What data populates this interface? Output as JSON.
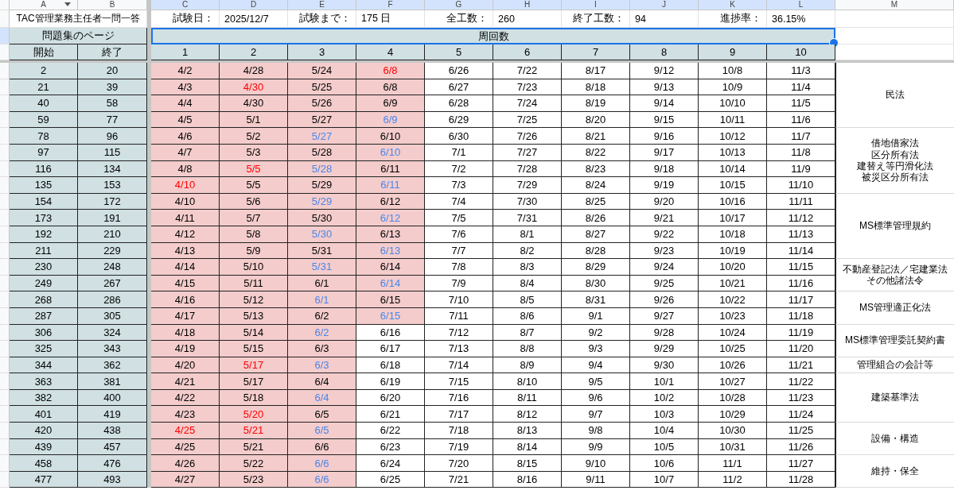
{
  "column_headers": [
    {
      "letter": "A",
      "selected": false,
      "dropdown": true
    },
    {
      "letter": "B",
      "selected": false
    },
    {
      "letter": "C",
      "selected": true
    },
    {
      "letter": "D",
      "selected": true
    },
    {
      "letter": "E",
      "selected": true
    },
    {
      "letter": "F",
      "selected": true
    },
    {
      "letter": "G",
      "selected": true
    },
    {
      "letter": "H",
      "selected": true
    },
    {
      "letter": "I",
      "selected": true
    },
    {
      "letter": "J",
      "selected": true
    },
    {
      "letter": "K",
      "selected": true
    },
    {
      "letter": "L",
      "selected": true
    },
    {
      "letter": "M",
      "selected": false
    }
  ],
  "title": "TAC管理業務主任者一問一答",
  "info": [
    {
      "label": "試験日：",
      "value": "2025/12/7"
    },
    {
      "label": "試験まで：",
      "value": "175 日"
    },
    {
      "label": "全工数：",
      "value": "260"
    },
    {
      "label": "終了工数：",
      "value": "94"
    },
    {
      "label": "進捗率：",
      "value": "36.15%"
    }
  ],
  "pages_header": "問題集のページ",
  "rounds_header": {
    "text": "周回数",
    "selected": true
  },
  "page_columns": [
    "開始",
    "終了"
  ],
  "round_numbers": [
    "1",
    "2",
    "3",
    "4",
    "5",
    "6",
    "7",
    "8",
    "9",
    "10"
  ],
  "groups": [
    {
      "subject": [
        "民法"
      ],
      "rows": [
        {
          "start": "2",
          "end": "20",
          "dates": [
            {
              "text": "4/2",
              "done": true,
              "color": "#000000"
            },
            {
              "text": "4/28",
              "done": true,
              "color": "#000000"
            },
            {
              "text": "5/24",
              "done": true,
              "color": "#000000"
            },
            {
              "text": "6/8",
              "done": true,
              "color": "#ff0000"
            },
            {
              "text": "6/26",
              "done": false,
              "color": "#000000"
            },
            {
              "text": "7/22",
              "done": false,
              "color": "#000000"
            },
            {
              "text": "8/17",
              "done": false,
              "color": "#000000"
            },
            {
              "text": "9/12",
              "done": false,
              "color": "#000000"
            },
            {
              "text": "10/8",
              "done": false,
              "color": "#000000"
            },
            {
              "text": "11/3",
              "done": false,
              "color": "#000000"
            }
          ]
        },
        {
          "start": "21",
          "end": "39",
          "dates": [
            {
              "text": "4/3",
              "done": true,
              "color": "#000000"
            },
            {
              "text": "4/30",
              "done": true,
              "color": "#ff0000"
            },
            {
              "text": "5/25",
              "done": true,
              "color": "#000000"
            },
            {
              "text": "6/8",
              "done": true,
              "color": "#000000"
            },
            {
              "text": "6/27",
              "done": false,
              "color": "#000000"
            },
            {
              "text": "7/23",
              "done": false,
              "color": "#000000"
            },
            {
              "text": "8/18",
              "done": false,
              "color": "#000000"
            },
            {
              "text": "9/13",
              "done": false,
              "color": "#000000"
            },
            {
              "text": "10/9",
              "done": false,
              "color": "#000000"
            },
            {
              "text": "11/4",
              "done": false,
              "color": "#000000"
            }
          ]
        },
        {
          "start": "40",
          "end": "58",
          "dates": [
            {
              "text": "4/4",
              "done": true,
              "color": "#000000"
            },
            {
              "text": "4/30",
              "done": true,
              "color": "#000000"
            },
            {
              "text": "5/26",
              "done": true,
              "color": "#000000"
            },
            {
              "text": "6/9",
              "done": true,
              "color": "#000000"
            },
            {
              "text": "6/28",
              "done": false,
              "color": "#000000"
            },
            {
              "text": "7/24",
              "done": false,
              "color": "#000000"
            },
            {
              "text": "8/19",
              "done": false,
              "color": "#000000"
            },
            {
              "text": "9/14",
              "done": false,
              "color": "#000000"
            },
            {
              "text": "10/10",
              "done": false,
              "color": "#000000"
            },
            {
              "text": "11/5",
              "done": false,
              "color": "#000000"
            }
          ]
        },
        {
          "start": "59",
          "end": "77",
          "dates": [
            {
              "text": "4/5",
              "done": true,
              "color": "#000000"
            },
            {
              "text": "5/1",
              "done": true,
              "color": "#000000"
            },
            {
              "text": "5/27",
              "done": true,
              "color": "#000000"
            },
            {
              "text": "6/9",
              "done": true,
              "color": "#4a86e8"
            },
            {
              "text": "6/29",
              "done": false,
              "color": "#000000"
            },
            {
              "text": "7/25",
              "done": false,
              "color": "#000000"
            },
            {
              "text": "8/20",
              "done": false,
              "color": "#000000"
            },
            {
              "text": "9/15",
              "done": false,
              "color": "#000000"
            },
            {
              "text": "10/11",
              "done": false,
              "color": "#000000"
            },
            {
              "text": "11/6",
              "done": false,
              "color": "#000000"
            }
          ]
        }
      ]
    },
    {
      "subject": [
        "借地借家法",
        "区分所有法",
        "建替え等円滑化法",
        "被災区分所有法"
      ],
      "rows": [
        {
          "start": "78",
          "end": "96",
          "dates": [
            {
              "text": "4/6",
              "done": true,
              "color": "#000000"
            },
            {
              "text": "5/2",
              "done": true,
              "color": "#000000"
            },
            {
              "text": "5/27",
              "done": true,
              "color": "#4a86e8"
            },
            {
              "text": "6/10",
              "done": true,
              "color": "#000000"
            },
            {
              "text": "6/30",
              "done": false,
              "color": "#000000"
            },
            {
              "text": "7/26",
              "done": false,
              "color": "#000000"
            },
            {
              "text": "8/21",
              "done": false,
              "color": "#000000"
            },
            {
              "text": "9/16",
              "done": false,
              "color": "#000000"
            },
            {
              "text": "10/12",
              "done": false,
              "color": "#000000"
            },
            {
              "text": "11/7",
              "done": false,
              "color": "#000000"
            }
          ]
        },
        {
          "start": "97",
          "end": "115",
          "dates": [
            {
              "text": "4/7",
              "done": true,
              "color": "#000000"
            },
            {
              "text": "5/3",
              "done": true,
              "color": "#000000"
            },
            {
              "text": "5/28",
              "done": true,
              "color": "#000000"
            },
            {
              "text": "6/10",
              "done": true,
              "color": "#4a86e8"
            },
            {
              "text": "7/1",
              "done": false,
              "color": "#000000"
            },
            {
              "text": "7/27",
              "done": false,
              "color": "#000000"
            },
            {
              "text": "8/22",
              "done": false,
              "color": "#000000"
            },
            {
              "text": "9/17",
              "done": false,
              "color": "#000000"
            },
            {
              "text": "10/13",
              "done": false,
              "color": "#000000"
            },
            {
              "text": "11/8",
              "done": false,
              "color": "#000000"
            }
          ]
        },
        {
          "start": "116",
          "end": "134",
          "dates": [
            {
              "text": "4/8",
              "done": true,
              "color": "#000000"
            },
            {
              "text": "5/5",
              "done": true,
              "color": "#ff0000"
            },
            {
              "text": "5/28",
              "done": true,
              "color": "#4a86e8"
            },
            {
              "text": "6/11",
              "done": true,
              "color": "#000000"
            },
            {
              "text": "7/2",
              "done": false,
              "color": "#000000"
            },
            {
              "text": "7/28",
              "done": false,
              "color": "#000000"
            },
            {
              "text": "8/23",
              "done": false,
              "color": "#000000"
            },
            {
              "text": "9/18",
              "done": false,
              "color": "#000000"
            },
            {
              "text": "10/14",
              "done": false,
              "color": "#000000"
            },
            {
              "text": "11/9",
              "done": false,
              "color": "#000000"
            }
          ]
        },
        {
          "start": "135",
          "end": "153",
          "dates": [
            {
              "text": "4/10",
              "done": true,
              "color": "#ff0000"
            },
            {
              "text": "5/5",
              "done": true,
              "color": "#000000"
            },
            {
              "text": "5/29",
              "done": true,
              "color": "#000000"
            },
            {
              "text": "6/11",
              "done": true,
              "color": "#4a86e8"
            },
            {
              "text": "7/3",
              "done": false,
              "color": "#000000"
            },
            {
              "text": "7/29",
              "done": false,
              "color": "#000000"
            },
            {
              "text": "8/24",
              "done": false,
              "color": "#000000"
            },
            {
              "text": "9/19",
              "done": false,
              "color": "#000000"
            },
            {
              "text": "10/15",
              "done": false,
              "color": "#000000"
            },
            {
              "text": "11/10",
              "done": false,
              "color": "#000000"
            }
          ]
        }
      ]
    },
    {
      "subject": [
        "MS標準管理規約"
      ],
      "rows": [
        {
          "start": "154",
          "end": "172",
          "dates": [
            {
              "text": "4/10",
              "done": true,
              "color": "#000000"
            },
            {
              "text": "5/6",
              "done": true,
              "color": "#000000"
            },
            {
              "text": "5/29",
              "done": true,
              "color": "#4a86e8"
            },
            {
              "text": "6/12",
              "done": true,
              "color": "#000000"
            },
            {
              "text": "7/4",
              "done": false,
              "color": "#000000"
            },
            {
              "text": "7/30",
              "done": false,
              "color": "#000000"
            },
            {
              "text": "8/25",
              "done": false,
              "color": "#000000"
            },
            {
              "text": "9/20",
              "done": false,
              "color": "#000000"
            },
            {
              "text": "10/16",
              "done": false,
              "color": "#000000"
            },
            {
              "text": "11/11",
              "done": false,
              "color": "#000000"
            }
          ]
        },
        {
          "start": "173",
          "end": "191",
          "dates": [
            {
              "text": "4/11",
              "done": true,
              "color": "#000000"
            },
            {
              "text": "5/7",
              "done": true,
              "color": "#000000"
            },
            {
              "text": "5/30",
              "done": true,
              "color": "#000000"
            },
            {
              "text": "6/12",
              "done": true,
              "color": "#4a86e8"
            },
            {
              "text": "7/5",
              "done": false,
              "color": "#000000"
            },
            {
              "text": "7/31",
              "done": false,
              "color": "#000000"
            },
            {
              "text": "8/26",
              "done": false,
              "color": "#000000"
            },
            {
              "text": "9/21",
              "done": false,
              "color": "#000000"
            },
            {
              "text": "10/17",
              "done": false,
              "color": "#000000"
            },
            {
              "text": "11/12",
              "done": false,
              "color": "#000000"
            }
          ]
        },
        {
          "start": "192",
          "end": "210",
          "dates": [
            {
              "text": "4/12",
              "done": true,
              "color": "#000000"
            },
            {
              "text": "5/8",
              "done": true,
              "color": "#000000"
            },
            {
              "text": "5/30",
              "done": true,
              "color": "#4a86e8"
            },
            {
              "text": "6/13",
              "done": true,
              "color": "#000000"
            },
            {
              "text": "7/6",
              "done": false,
              "color": "#000000"
            },
            {
              "text": "8/1",
              "done": false,
              "color": "#000000"
            },
            {
              "text": "8/27",
              "done": false,
              "color": "#000000"
            },
            {
              "text": "9/22",
              "done": false,
              "color": "#000000"
            },
            {
              "text": "10/18",
              "done": false,
              "color": "#000000"
            },
            {
              "text": "11/13",
              "done": false,
              "color": "#000000"
            }
          ]
        },
        {
          "start": "211",
          "end": "229",
          "dates": [
            {
              "text": "4/13",
              "done": true,
              "color": "#000000"
            },
            {
              "text": "5/9",
              "done": true,
              "color": "#000000"
            },
            {
              "text": "5/31",
              "done": true,
              "color": "#000000"
            },
            {
              "text": "6/13",
              "done": true,
              "color": "#4a86e8"
            },
            {
              "text": "7/7",
              "done": false,
              "color": "#000000"
            },
            {
              "text": "8/2",
              "done": false,
              "color": "#000000"
            },
            {
              "text": "8/28",
              "done": false,
              "color": "#000000"
            },
            {
              "text": "9/23",
              "done": false,
              "color": "#000000"
            },
            {
              "text": "10/19",
              "done": false,
              "color": "#000000"
            },
            {
              "text": "11/14",
              "done": false,
              "color": "#000000"
            }
          ]
        }
      ]
    },
    {
      "subject": [
        "不動産登記法／宅建業法",
        "その他諸法令"
      ],
      "rows": [
        {
          "start": "230",
          "end": "248",
          "dates": [
            {
              "text": "4/14",
              "done": true,
              "color": "#000000"
            },
            {
              "text": "5/10",
              "done": true,
              "color": "#000000"
            },
            {
              "text": "5/31",
              "done": true,
              "color": "#4a86e8"
            },
            {
              "text": "6/14",
              "done": true,
              "color": "#000000"
            },
            {
              "text": "7/8",
              "done": false,
              "color": "#000000"
            },
            {
              "text": "8/3",
              "done": false,
              "color": "#000000"
            },
            {
              "text": "8/29",
              "done": false,
              "color": "#000000"
            },
            {
              "text": "9/24",
              "done": false,
              "color": "#000000"
            },
            {
              "text": "10/20",
              "done": false,
              "color": "#000000"
            },
            {
              "text": "11/15",
              "done": false,
              "color": "#000000"
            }
          ]
        },
        {
          "start": "249",
          "end": "267",
          "dates": [
            {
              "text": "4/15",
              "done": true,
              "color": "#000000"
            },
            {
              "text": "5/11",
              "done": true,
              "color": "#000000"
            },
            {
              "text": "6/1",
              "done": true,
              "color": "#000000"
            },
            {
              "text": "6/14",
              "done": true,
              "color": "#4a86e8"
            },
            {
              "text": "7/9",
              "done": false,
              "color": "#000000"
            },
            {
              "text": "8/4",
              "done": false,
              "color": "#000000"
            },
            {
              "text": "8/30",
              "done": false,
              "color": "#000000"
            },
            {
              "text": "9/25",
              "done": false,
              "color": "#000000"
            },
            {
              "text": "10/21",
              "done": false,
              "color": "#000000"
            },
            {
              "text": "11/16",
              "done": false,
              "color": "#000000"
            }
          ]
        }
      ]
    },
    {
      "subject": [
        "MS管理適正化法"
      ],
      "rows": [
        {
          "start": "268",
          "end": "286",
          "dates": [
            {
              "text": "4/16",
              "done": true,
              "color": "#000000"
            },
            {
              "text": "5/12",
              "done": true,
              "color": "#000000"
            },
            {
              "text": "6/1",
              "done": true,
              "color": "#4a86e8"
            },
            {
              "text": "6/15",
              "done": true,
              "color": "#000000"
            },
            {
              "text": "7/10",
              "done": false,
              "color": "#000000"
            },
            {
              "text": "8/5",
              "done": false,
              "color": "#000000"
            },
            {
              "text": "8/31",
              "done": false,
              "color": "#000000"
            },
            {
              "text": "9/26",
              "done": false,
              "color": "#000000"
            },
            {
              "text": "10/22",
              "done": false,
              "color": "#000000"
            },
            {
              "text": "11/17",
              "done": false,
              "color": "#000000"
            }
          ]
        },
        {
          "start": "287",
          "end": "305",
          "dates": [
            {
              "text": "4/17",
              "done": true,
              "color": "#000000"
            },
            {
              "text": "5/13",
              "done": true,
              "color": "#000000"
            },
            {
              "text": "6/2",
              "done": true,
              "color": "#000000"
            },
            {
              "text": "6/15",
              "done": true,
              "color": "#4a86e8"
            },
            {
              "text": "7/11",
              "done": false,
              "color": "#000000"
            },
            {
              "text": "8/6",
              "done": false,
              "color": "#000000"
            },
            {
              "text": "9/1",
              "done": false,
              "color": "#000000"
            },
            {
              "text": "9/27",
              "done": false,
              "color": "#000000"
            },
            {
              "text": "10/23",
              "done": false,
              "color": "#000000"
            },
            {
              "text": "11/18",
              "done": false,
              "color": "#000000"
            }
          ]
        }
      ]
    },
    {
      "subject": [
        "MS標準管理委託契約書"
      ],
      "rows": [
        {
          "start": "306",
          "end": "324",
          "dates": [
            {
              "text": "4/18",
              "done": true,
              "color": "#000000"
            },
            {
              "text": "5/14",
              "done": true,
              "color": "#000000"
            },
            {
              "text": "6/2",
              "done": true,
              "color": "#4a86e8"
            },
            {
              "text": "6/16",
              "done": false,
              "color": "#000000"
            },
            {
              "text": "7/12",
              "done": false,
              "color": "#000000"
            },
            {
              "text": "8/7",
              "done": false,
              "color": "#000000"
            },
            {
              "text": "9/2",
              "done": false,
              "color": "#000000"
            },
            {
              "text": "9/28",
              "done": false,
              "color": "#000000"
            },
            {
              "text": "10/24",
              "done": false,
              "color": "#000000"
            },
            {
              "text": "11/19",
              "done": false,
              "color": "#000000"
            }
          ]
        },
        {
          "start": "325",
          "end": "343",
          "dates": [
            {
              "text": "4/19",
              "done": true,
              "color": "#000000"
            },
            {
              "text": "5/15",
              "done": true,
              "color": "#000000"
            },
            {
              "text": "6/3",
              "done": true,
              "color": "#000000"
            },
            {
              "text": "6/17",
              "done": false,
              "color": "#000000"
            },
            {
              "text": "7/13",
              "done": false,
              "color": "#000000"
            },
            {
              "text": "8/8",
              "done": false,
              "color": "#000000"
            },
            {
              "text": "9/3",
              "done": false,
              "color": "#000000"
            },
            {
              "text": "9/29",
              "done": false,
              "color": "#000000"
            },
            {
              "text": "10/25",
              "done": false,
              "color": "#000000"
            },
            {
              "text": "11/20",
              "done": false,
              "color": "#000000"
            }
          ]
        }
      ]
    },
    {
      "subject": [
        "管理組合の会計等"
      ],
      "rows": [
        {
          "start": "344",
          "end": "362",
          "dates": [
            {
              "text": "4/20",
              "done": true,
              "color": "#000000"
            },
            {
              "text": "5/17",
              "done": true,
              "color": "#ff0000"
            },
            {
              "text": "6/3",
              "done": true,
              "color": "#4a86e8"
            },
            {
              "text": "6/18",
              "done": false,
              "color": "#000000"
            },
            {
              "text": "7/14",
              "done": false,
              "color": "#000000"
            },
            {
              "text": "8/9",
              "done": false,
              "color": "#000000"
            },
            {
              "text": "9/4",
              "done": false,
              "color": "#000000"
            },
            {
              "text": "9/30",
              "done": false,
              "color": "#000000"
            },
            {
              "text": "10/26",
              "done": false,
              "color": "#000000"
            },
            {
              "text": "11/21",
              "done": false,
              "color": "#000000"
            }
          ]
        }
      ]
    },
    {
      "subject": [
        "建築基準法"
      ],
      "rows": [
        {
          "start": "363",
          "end": "381",
          "dates": [
            {
              "text": "4/21",
              "done": true,
              "color": "#000000"
            },
            {
              "text": "5/17",
              "done": true,
              "color": "#000000"
            },
            {
              "text": "6/4",
              "done": true,
              "color": "#000000"
            },
            {
              "text": "6/19",
              "done": false,
              "color": "#000000"
            },
            {
              "text": "7/15",
              "done": false,
              "color": "#000000"
            },
            {
              "text": "8/10",
              "done": false,
              "color": "#000000"
            },
            {
              "text": "9/5",
              "done": false,
              "color": "#000000"
            },
            {
              "text": "10/1",
              "done": false,
              "color": "#000000"
            },
            {
              "text": "10/27",
              "done": false,
              "color": "#000000"
            },
            {
              "text": "11/22",
              "done": false,
              "color": "#000000"
            }
          ]
        },
        {
          "start": "382",
          "end": "400",
          "dates": [
            {
              "text": "4/22",
              "done": true,
              "color": "#000000"
            },
            {
              "text": "5/18",
              "done": true,
              "color": "#000000"
            },
            {
              "text": "6/4",
              "done": true,
              "color": "#4a86e8"
            },
            {
              "text": "6/20",
              "done": false,
              "color": "#000000"
            },
            {
              "text": "7/16",
              "done": false,
              "color": "#000000"
            },
            {
              "text": "8/11",
              "done": false,
              "color": "#000000"
            },
            {
              "text": "9/6",
              "done": false,
              "color": "#000000"
            },
            {
              "text": "10/2",
              "done": false,
              "color": "#000000"
            },
            {
              "text": "10/28",
              "done": false,
              "color": "#000000"
            },
            {
              "text": "11/23",
              "done": false,
              "color": "#000000"
            }
          ]
        },
        {
          "start": "401",
          "end": "419",
          "dates": [
            {
              "text": "4/23",
              "done": true,
              "color": "#000000"
            },
            {
              "text": "5/20",
              "done": true,
              "color": "#ff0000"
            },
            {
              "text": "6/5",
              "done": true,
              "color": "#000000"
            },
            {
              "text": "6/21",
              "done": false,
              "color": "#000000"
            },
            {
              "text": "7/17",
              "done": false,
              "color": "#000000"
            },
            {
              "text": "8/12",
              "done": false,
              "color": "#000000"
            },
            {
              "text": "9/7",
              "done": false,
              "color": "#000000"
            },
            {
              "text": "10/3",
              "done": false,
              "color": "#000000"
            },
            {
              "text": "10/29",
              "done": false,
              "color": "#000000"
            },
            {
              "text": "11/24",
              "done": false,
              "color": "#000000"
            }
          ]
        }
      ]
    },
    {
      "subject": [
        "設備・構造"
      ],
      "rows": [
        {
          "start": "420",
          "end": "438",
          "dates": [
            {
              "text": "4/25",
              "done": true,
              "color": "#ff0000"
            },
            {
              "text": "5/21",
              "done": true,
              "color": "#ff0000"
            },
            {
              "text": "6/5",
              "done": true,
              "color": "#4a86e8"
            },
            {
              "text": "6/22",
              "done": false,
              "color": "#000000"
            },
            {
              "text": "7/18",
              "done": false,
              "color": "#000000"
            },
            {
              "text": "8/13",
              "done": false,
              "color": "#000000"
            },
            {
              "text": "9/8",
              "done": false,
              "color": "#000000"
            },
            {
              "text": "10/4",
              "done": false,
              "color": "#000000"
            },
            {
              "text": "10/30",
              "done": false,
              "color": "#000000"
            },
            {
              "text": "11/25",
              "done": false,
              "color": "#000000"
            }
          ]
        },
        {
          "start": "439",
          "end": "457",
          "dates": [
            {
              "text": "4/25",
              "done": true,
              "color": "#000000"
            },
            {
              "text": "5/21",
              "done": true,
              "color": "#000000"
            },
            {
              "text": "6/6",
              "done": true,
              "color": "#000000"
            },
            {
              "text": "6/23",
              "done": false,
              "color": "#000000"
            },
            {
              "text": "7/19",
              "done": false,
              "color": "#000000"
            },
            {
              "text": "8/14",
              "done": false,
              "color": "#000000"
            },
            {
              "text": "9/9",
              "done": false,
              "color": "#000000"
            },
            {
              "text": "10/5",
              "done": false,
              "color": "#000000"
            },
            {
              "text": "10/31",
              "done": false,
              "color": "#000000"
            },
            {
              "text": "11/26",
              "done": false,
              "color": "#000000"
            }
          ]
        }
      ]
    },
    {
      "subject": [
        "維持・保全"
      ],
      "rows": [
        {
          "start": "458",
          "end": "476",
          "dates": [
            {
              "text": "4/26",
              "done": true,
              "color": "#000000"
            },
            {
              "text": "5/22",
              "done": true,
              "color": "#000000"
            },
            {
              "text": "6/6",
              "done": true,
              "color": "#4a86e8"
            },
            {
              "text": "6/24",
              "done": false,
              "color": "#000000"
            },
            {
              "text": "7/20",
              "done": false,
              "color": "#000000"
            },
            {
              "text": "8/15",
              "done": false,
              "color": "#000000"
            },
            {
              "text": "9/10",
              "done": false,
              "color": "#000000"
            },
            {
              "text": "10/6",
              "done": false,
              "color": "#000000"
            },
            {
              "text": "11/1",
              "done": false,
              "color": "#000000"
            },
            {
              "text": "11/27",
              "done": false,
              "color": "#000000"
            }
          ]
        },
        {
          "start": "477",
          "end": "493",
          "dates": [
            {
              "text": "4/27",
              "done": true,
              "color": "#000000"
            },
            {
              "text": "5/23",
              "done": true,
              "color": "#000000"
            },
            {
              "text": "6/6",
              "done": true,
              "color": "#4a86e8"
            },
            {
              "text": "6/25",
              "done": false,
              "color": "#000000"
            },
            {
              "text": "7/21",
              "done": false,
              "color": "#000000"
            },
            {
              "text": "8/16",
              "done": false,
              "color": "#000000"
            },
            {
              "text": "9/11",
              "done": false,
              "color": "#000000"
            },
            {
              "text": "10/7",
              "done": false,
              "color": "#000000"
            },
            {
              "text": "11/2",
              "done": false,
              "color": "#000000"
            },
            {
              "text": "11/28",
              "done": false,
              "color": "#000000"
            }
          ]
        }
      ]
    }
  ]
}
